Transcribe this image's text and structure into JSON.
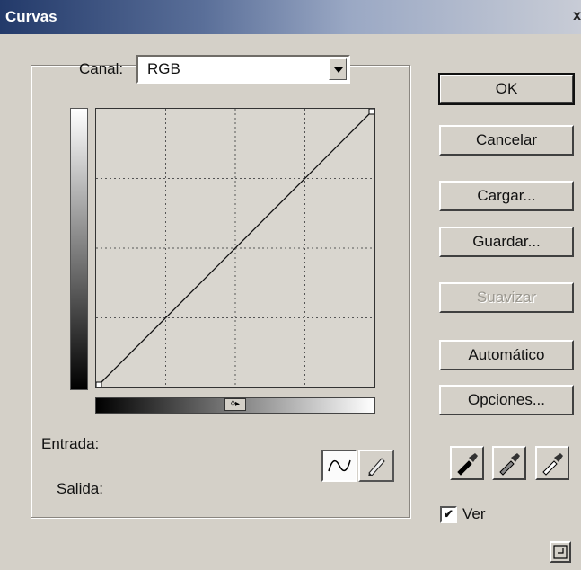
{
  "window": {
    "title": "Curvas",
    "close_glyph": "x"
  },
  "channel": {
    "label": "Canal:",
    "selected": "RGB"
  },
  "curve": {
    "input_label": "Entrada:",
    "output_label": "Salida:",
    "slider_glyph": "◊▸"
  },
  "buttons": {
    "ok": "OK",
    "cancel": "Cancelar",
    "load": "Cargar...",
    "save": "Guardar...",
    "smooth": "Suavizar",
    "auto": "Automático",
    "options": "Opciones..."
  },
  "preview": {
    "label": "Ver",
    "checked": true,
    "check_glyph": "✔"
  },
  "icons": {
    "curve_tool": "curve-tool-icon",
    "pencil_tool": "pencil-tool-icon",
    "black_eyedropper": "eyedropper-black-icon",
    "gray_eyedropper": "eyedropper-gray-icon",
    "white_eyedropper": "eyedropper-white-icon",
    "resize": "resize-icon"
  },
  "colors": {
    "dialog_bg": "#d4d0c8",
    "title_start": "#233a6a",
    "grid": "#555555"
  }
}
